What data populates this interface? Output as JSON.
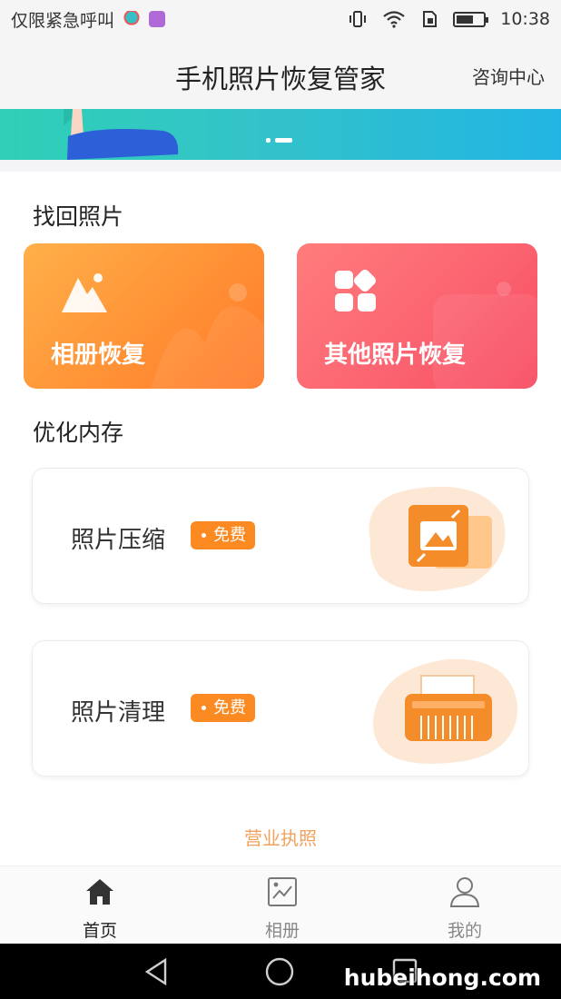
{
  "status_bar": {
    "carrier_text": "仅限紧急呼叫",
    "time": "10:38",
    "icons": [
      "vibrate-icon",
      "wifi-icon",
      "sim-icon",
      "battery-icon"
    ]
  },
  "header": {
    "title": "手机照片恢复管家",
    "help_link": "咨询中心"
  },
  "sections": {
    "recover_title": "找回照片",
    "optimize_title": "优化内存"
  },
  "recover_cards": [
    {
      "label": "相册恢复",
      "icon": "mountain-icon"
    },
    {
      "label": "其他照片恢复",
      "icon": "grid-icon"
    }
  ],
  "optimize_cards": [
    {
      "label": "照片压缩",
      "badge": "免费",
      "icon": "compress-photo-icon"
    },
    {
      "label": "照片清理",
      "badge": "免费",
      "icon": "shredder-icon"
    }
  ],
  "footer_link": "营业执照",
  "tabs": [
    {
      "label": "首页",
      "icon": "home-icon",
      "active": true
    },
    {
      "label": "相册",
      "icon": "album-icon",
      "active": false
    },
    {
      "label": "我的",
      "icon": "user-icon",
      "active": false
    }
  ],
  "watermark": "hubeihong.com",
  "colors": {
    "accent_orange": "#fb8a22",
    "card_orange": "#ff9436",
    "card_red": "#fb6270",
    "banner_teal": "#33c3c9"
  }
}
